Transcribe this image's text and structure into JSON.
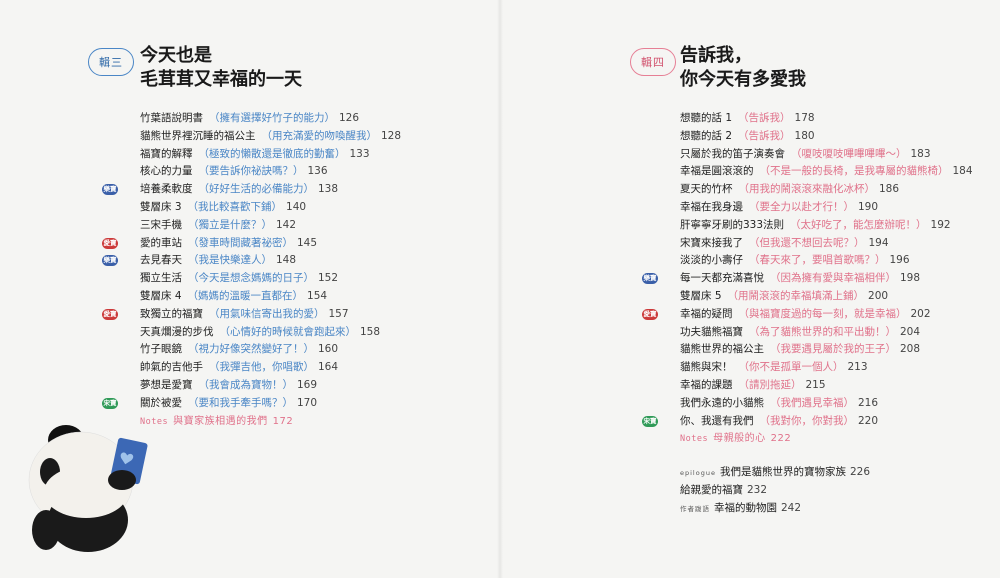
{
  "left": {
    "badge": "輯三",
    "title_line1": "今天也是",
    "title_line2": "毛茸茸又幸福的一天",
    "items": [
      {
        "title": "竹葉語說明書",
        "sub": "（擁有選擇好竹子的能力）",
        "page": "126",
        "badge": ""
      },
      {
        "title": "貓熊世界裡沉睡的福公主",
        "sub": "（用充滿愛的吻喚醒我）",
        "page": "128",
        "badge": ""
      },
      {
        "title": "福寶的解釋",
        "sub": "（極致的懶散還是徹底的勤奮）",
        "page": "133",
        "badge": ""
      },
      {
        "title": "核心的力量",
        "sub": "（要告訴你祕訣嗎？）",
        "page": "136",
        "badge": ""
      },
      {
        "title": "培養柔軟度",
        "sub": "（好好生活的必備能力）",
        "page": "138",
        "badge": "樂寶",
        "badge_color": "blue"
      },
      {
        "title": "雙層床 3",
        "sub": "（我比較喜歡下鋪）",
        "page": "140",
        "badge": ""
      },
      {
        "title": "三宋手機",
        "sub": "（獨立是什麼？）",
        "page": "142",
        "badge": ""
      },
      {
        "title": "愛的車站",
        "sub": "（發車時間藏著祕密）",
        "page": "145",
        "badge": "愛寶",
        "badge_color": "red"
      },
      {
        "title": "去見春天",
        "sub": "（我是快樂達人）",
        "page": "148",
        "badge": "樂寶",
        "badge_color": "blue"
      },
      {
        "title": "獨立生活",
        "sub": "（今天是想念媽媽的日子）",
        "page": "152",
        "badge": ""
      },
      {
        "title": "雙層床 4",
        "sub": "（媽媽的溫暖一直都在）",
        "page": "154",
        "badge": ""
      },
      {
        "title": "致獨立的福寶",
        "sub": "（用氣味信寄出我的愛）",
        "page": "157",
        "badge": "愛寶",
        "badge_color": "red"
      },
      {
        "title": "天真爛漫的步伐",
        "sub": "（心情好的時候就會跑起來）",
        "page": "158",
        "badge": ""
      },
      {
        "title": "竹子眼鏡",
        "sub": "（視力好像突然變好了！）",
        "page": "160",
        "badge": ""
      },
      {
        "title": "帥氣的吉他手",
        "sub": "（我彈吉他，你唱歌）",
        "page": "164",
        "badge": ""
      },
      {
        "title": "夢想是愛寶",
        "sub": "（我會成為寶物！）",
        "page": "169",
        "badge": ""
      },
      {
        "title": "關於被愛",
        "sub": "（要和我手牽手嗎？）",
        "page": "170",
        "badge": "宋寶",
        "badge_color": "green"
      }
    ],
    "notes_lat": "Notes",
    "notes_title": "與寶家族相遇的我們",
    "notes_page": "172"
  },
  "right": {
    "badge": "輯四",
    "title_line1": "告訴我，",
    "title_line2": "你今天有多愛我",
    "items": [
      {
        "title": "想聽的話 1",
        "sub": "（告訴我）",
        "page": "178",
        "badge": ""
      },
      {
        "title": "想聽的話 2",
        "sub": "（告訴我）",
        "page": "180",
        "badge": ""
      },
      {
        "title": "只屬於我的笛子演奏會",
        "sub": "（嗄吱嗄吱嗶嗶嗶嗶～）",
        "page": "183",
        "badge": ""
      },
      {
        "title": "幸福是圓滾滾的",
        "sub": "（不是一般的長椅，是我專屬的貓熊椅）",
        "page": "184",
        "badge": ""
      },
      {
        "title": "夏天的竹杯",
        "sub": "（用我的鬧滾滾來融化冰杯）",
        "page": "186",
        "badge": ""
      },
      {
        "title": "幸福在我身邊",
        "sub": "（要全力以赴才行！）",
        "page": "190",
        "badge": ""
      },
      {
        "title": "肝寧寧牙刷的333法則",
        "sub": "（太好吃了，能怎麼辦呢！）",
        "page": "192",
        "badge": ""
      },
      {
        "title": "宋寶來接我了",
        "sub": "（但我還不想回去呢？）",
        "page": "194",
        "badge": ""
      },
      {
        "title": "淡淡的小壽仔",
        "sub": "（春天來了，要唱首歌嗎？）",
        "page": "196",
        "badge": ""
      },
      {
        "title": "每一天都充滿喜悅",
        "sub": "（因為擁有愛與幸福相伴）",
        "page": "198",
        "badge": "樂寶",
        "badge_color": "blue"
      },
      {
        "title": "雙層床 5",
        "sub": "（用鬧滾滾的幸福填滿上鋪）",
        "page": "200",
        "badge": ""
      },
      {
        "title": "幸福的疑問",
        "sub": "（與福寶度過的每一刻，就是幸福）",
        "page": "202",
        "badge": "愛寶",
        "badge_color": "red"
      },
      {
        "title": "功夫貓熊福寶",
        "sub": "（為了貓熊世界的和平出動！）",
        "page": "204",
        "badge": ""
      },
      {
        "title": "貓熊世界的福公主",
        "sub": "（我要遇見屬於我的王子）",
        "page": "208",
        "badge": ""
      },
      {
        "title": "貓熊與宋！",
        "sub": "（你不是孤單一個人）",
        "page": "213",
        "badge": ""
      },
      {
        "title": "幸福的課題",
        "sub": "（請別拖延）",
        "page": "215",
        "badge": ""
      },
      {
        "title": "我們永遠的小貓熊",
        "sub": "（我們遇見幸福）",
        "page": "216",
        "badge": ""
      },
      {
        "title": "你、我還有我們",
        "sub": "（我對你，你對我）",
        "page": "220",
        "badge": "宋寶",
        "badge_color": "green"
      }
    ],
    "notes_lat": "Notes",
    "notes_title": "母親般的心",
    "notes_page": "222",
    "epilogue": [
      {
        "label": "epilogue",
        "title": "我們是貓熊世界的寶物家族",
        "page": "226"
      },
      {
        "label": "",
        "title": "給親愛的福寶",
        "page": "232"
      },
      {
        "label": "作者跋語",
        "title": "幸福的動物園",
        "page": "242"
      }
    ]
  }
}
